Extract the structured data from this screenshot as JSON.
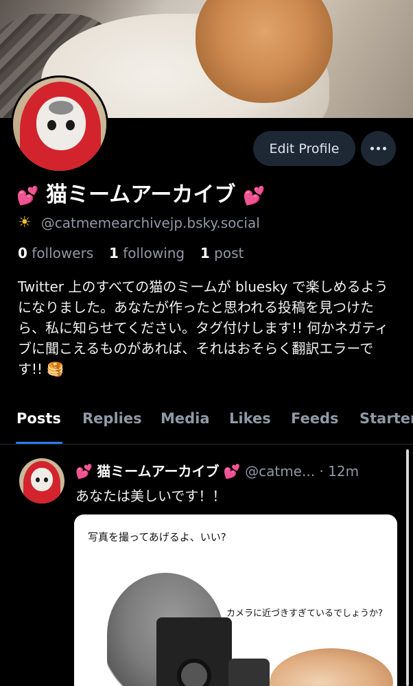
{
  "profile": {
    "edit_label": "Edit Profile",
    "more_icon": "ellipsis-icon",
    "heart_icon": "💕",
    "display_name": "猫ミームアーカイブ",
    "handle_icon": "sunrise-icon",
    "handle": "@catmemearchivejp.bsky.social",
    "followers_count": "0",
    "followers_label": "followers",
    "following_count": "1",
    "following_label": "following",
    "posts_count": "1",
    "posts_label": "post",
    "bio": "Twitter 上のすべての猫のミームが bluesky で楽しめるようになりました。あなたが作ったと思われる投稿を見つけたら、私に知らせてください。タグ付けします!! 何かネガティブに聞こえるものがあれば、それはおそらく翻訳エラーです!! 🥞"
  },
  "tabs": [
    "Posts",
    "Replies",
    "Media",
    "Likes",
    "Feeds",
    "Starter"
  ],
  "active_tab": "Posts",
  "post": {
    "author": "猫ミームアーカイブ",
    "handle": "@catme...",
    "separator": "·",
    "time": "12m",
    "text": "あなたは美しいです！！",
    "image_caption_top": "写真を撮ってあげるよ、いい?",
    "image_caption_side": "カメラに近づきすぎているでしょうか?"
  },
  "colors": {
    "accent": "#2a7ef7",
    "heart": "#ff4fb0",
    "muted_text": "#8f99a6",
    "button_bg": "#1e2835"
  }
}
